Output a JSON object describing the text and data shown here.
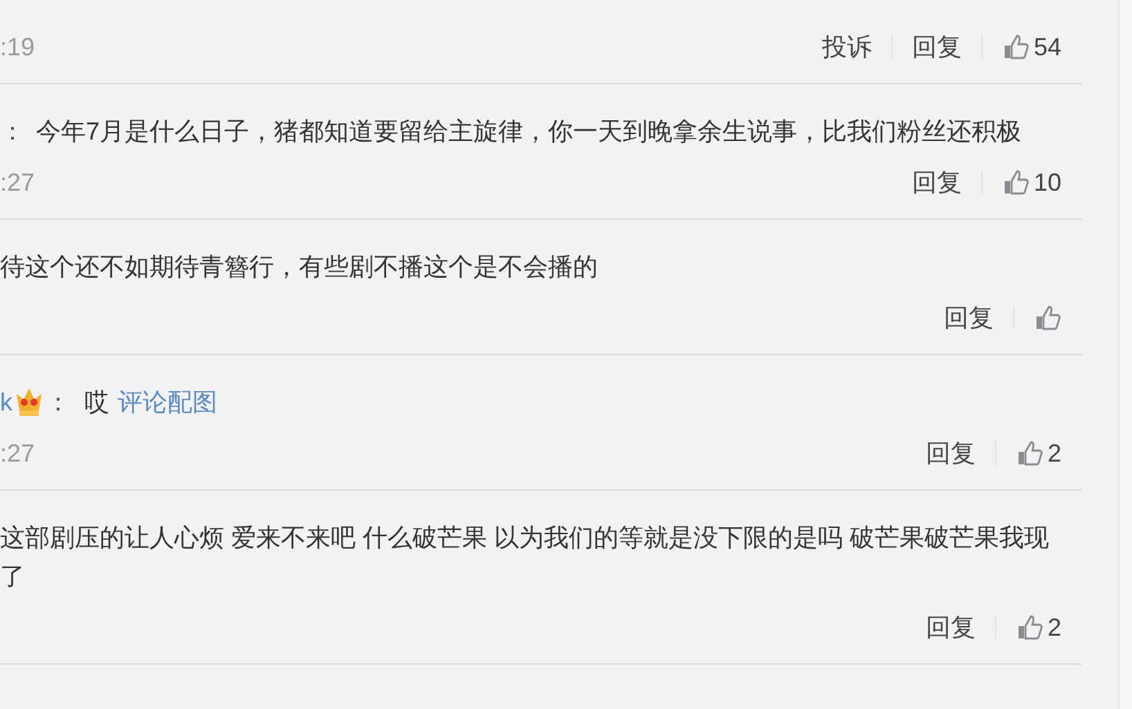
{
  "comments": [
    {
      "time": ":19",
      "actions": [
        "投诉",
        "回复"
      ],
      "likes": "54"
    },
    {
      "colon": "：",
      "lines": [
        "今年7月是什么日子，猪都知道要留给主旋律，你一天到晚拿余生说事，比我们粉丝还积极"
      ],
      "time": ":27",
      "actions": [
        "回复"
      ],
      "likes": "10"
    },
    {
      "lines": [
        "待这个还不如期待青簪行，有些剧不播这个是不会播的"
      ],
      "actions": [
        "回复"
      ]
    },
    {
      "author": "k",
      "badge": {
        "kind": "crown"
      },
      "colon": "：",
      "lines": [
        "哎"
      ],
      "link": "评论配图",
      "time": ":27",
      "actions": [
        "回复"
      ],
      "likes": "2"
    },
    {
      "lines": [
        "这部剧压的让人心烦 爱来不来吧 什么破芒果 以为我们的等就是没下限的是吗 破芒果破芒果我现",
        "了"
      ],
      "actions": [
        "回复"
      ],
      "likes": "2"
    }
  ]
}
